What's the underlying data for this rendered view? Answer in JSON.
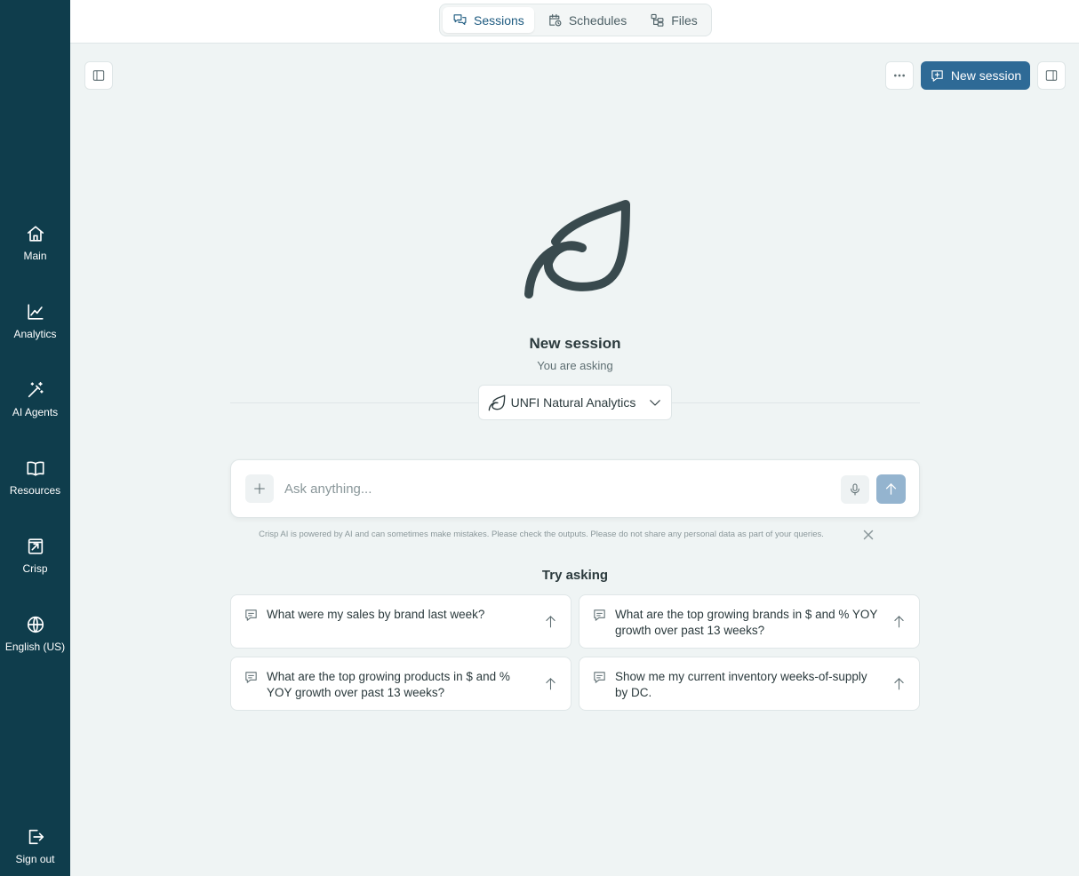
{
  "sidebar": {
    "items": [
      {
        "label": "Main",
        "icon": "home-icon"
      },
      {
        "label": "Analytics",
        "icon": "line-chart-icon"
      },
      {
        "label": "AI Agents",
        "icon": "magic-wand-icon"
      },
      {
        "label": "Resources",
        "icon": "book-icon"
      },
      {
        "label": "Crisp",
        "icon": "crisp-icon"
      },
      {
        "label": "English (US)",
        "icon": "globe-icon"
      }
    ],
    "signout_label": "Sign out"
  },
  "tabs": [
    {
      "label": "Sessions",
      "active": true
    },
    {
      "label": "Schedules",
      "active": false
    },
    {
      "label": "Files",
      "active": false
    }
  ],
  "toolbar": {
    "new_session_label": "New session"
  },
  "hero": {
    "title": "New session",
    "subtitle": "You are asking",
    "model": "UNFI Natural Analytics"
  },
  "ask": {
    "placeholder": "Ask anything..."
  },
  "disclaimer": "Crisp AI is powered by AI and can sometimes make mistakes. Please check the outputs. Please do not share any personal data as part of your queries.",
  "suggestions": {
    "title": "Try asking",
    "items": [
      "What were my sales by brand last week?",
      "What are the top growing brands in $ and % YOY growth over past 13 weeks?",
      "What are the top growing products in $ and % YOY growth over past 13 weeks?",
      "Show me my current inventory weeks-of-supply by DC."
    ]
  },
  "colors": {
    "sidebar": "#0f3d4c",
    "primary": "#2e6a96",
    "background": "#eff4f4",
    "send_disabled": "#94b4cf"
  }
}
